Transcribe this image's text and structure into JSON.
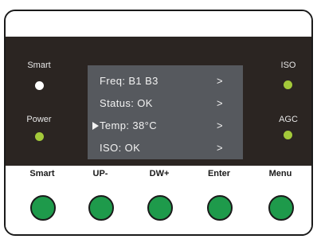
{
  "indicators": {
    "smart": {
      "label": "Smart",
      "led_color": "#ffffff"
    },
    "power": {
      "label": "Power",
      "led_color": "#a3c93a"
    },
    "iso": {
      "label": "ISO",
      "led_color": "#a3c93a"
    },
    "agc": {
      "label": "AGC",
      "led_color": "#a3c93a"
    }
  },
  "lcd": {
    "background": "#56595e",
    "selected_index": 2,
    "rows": [
      {
        "text": "Freq: B1 B3",
        "arrow": ">"
      },
      {
        "text": "Status: OK",
        "arrow": ">"
      },
      {
        "text": "Temp: 38°C",
        "arrow": ">"
      },
      {
        "text": "ISO: OK",
        "arrow": ">"
      }
    ]
  },
  "buttons": [
    {
      "label": "Smart"
    },
    {
      "label": "UP-"
    },
    {
      "label": "DW+"
    },
    {
      "label": "Enter"
    },
    {
      "label": "Menu"
    }
  ],
  "colors": {
    "panel": "#2b2522",
    "button_green": "#1e9a4b"
  }
}
